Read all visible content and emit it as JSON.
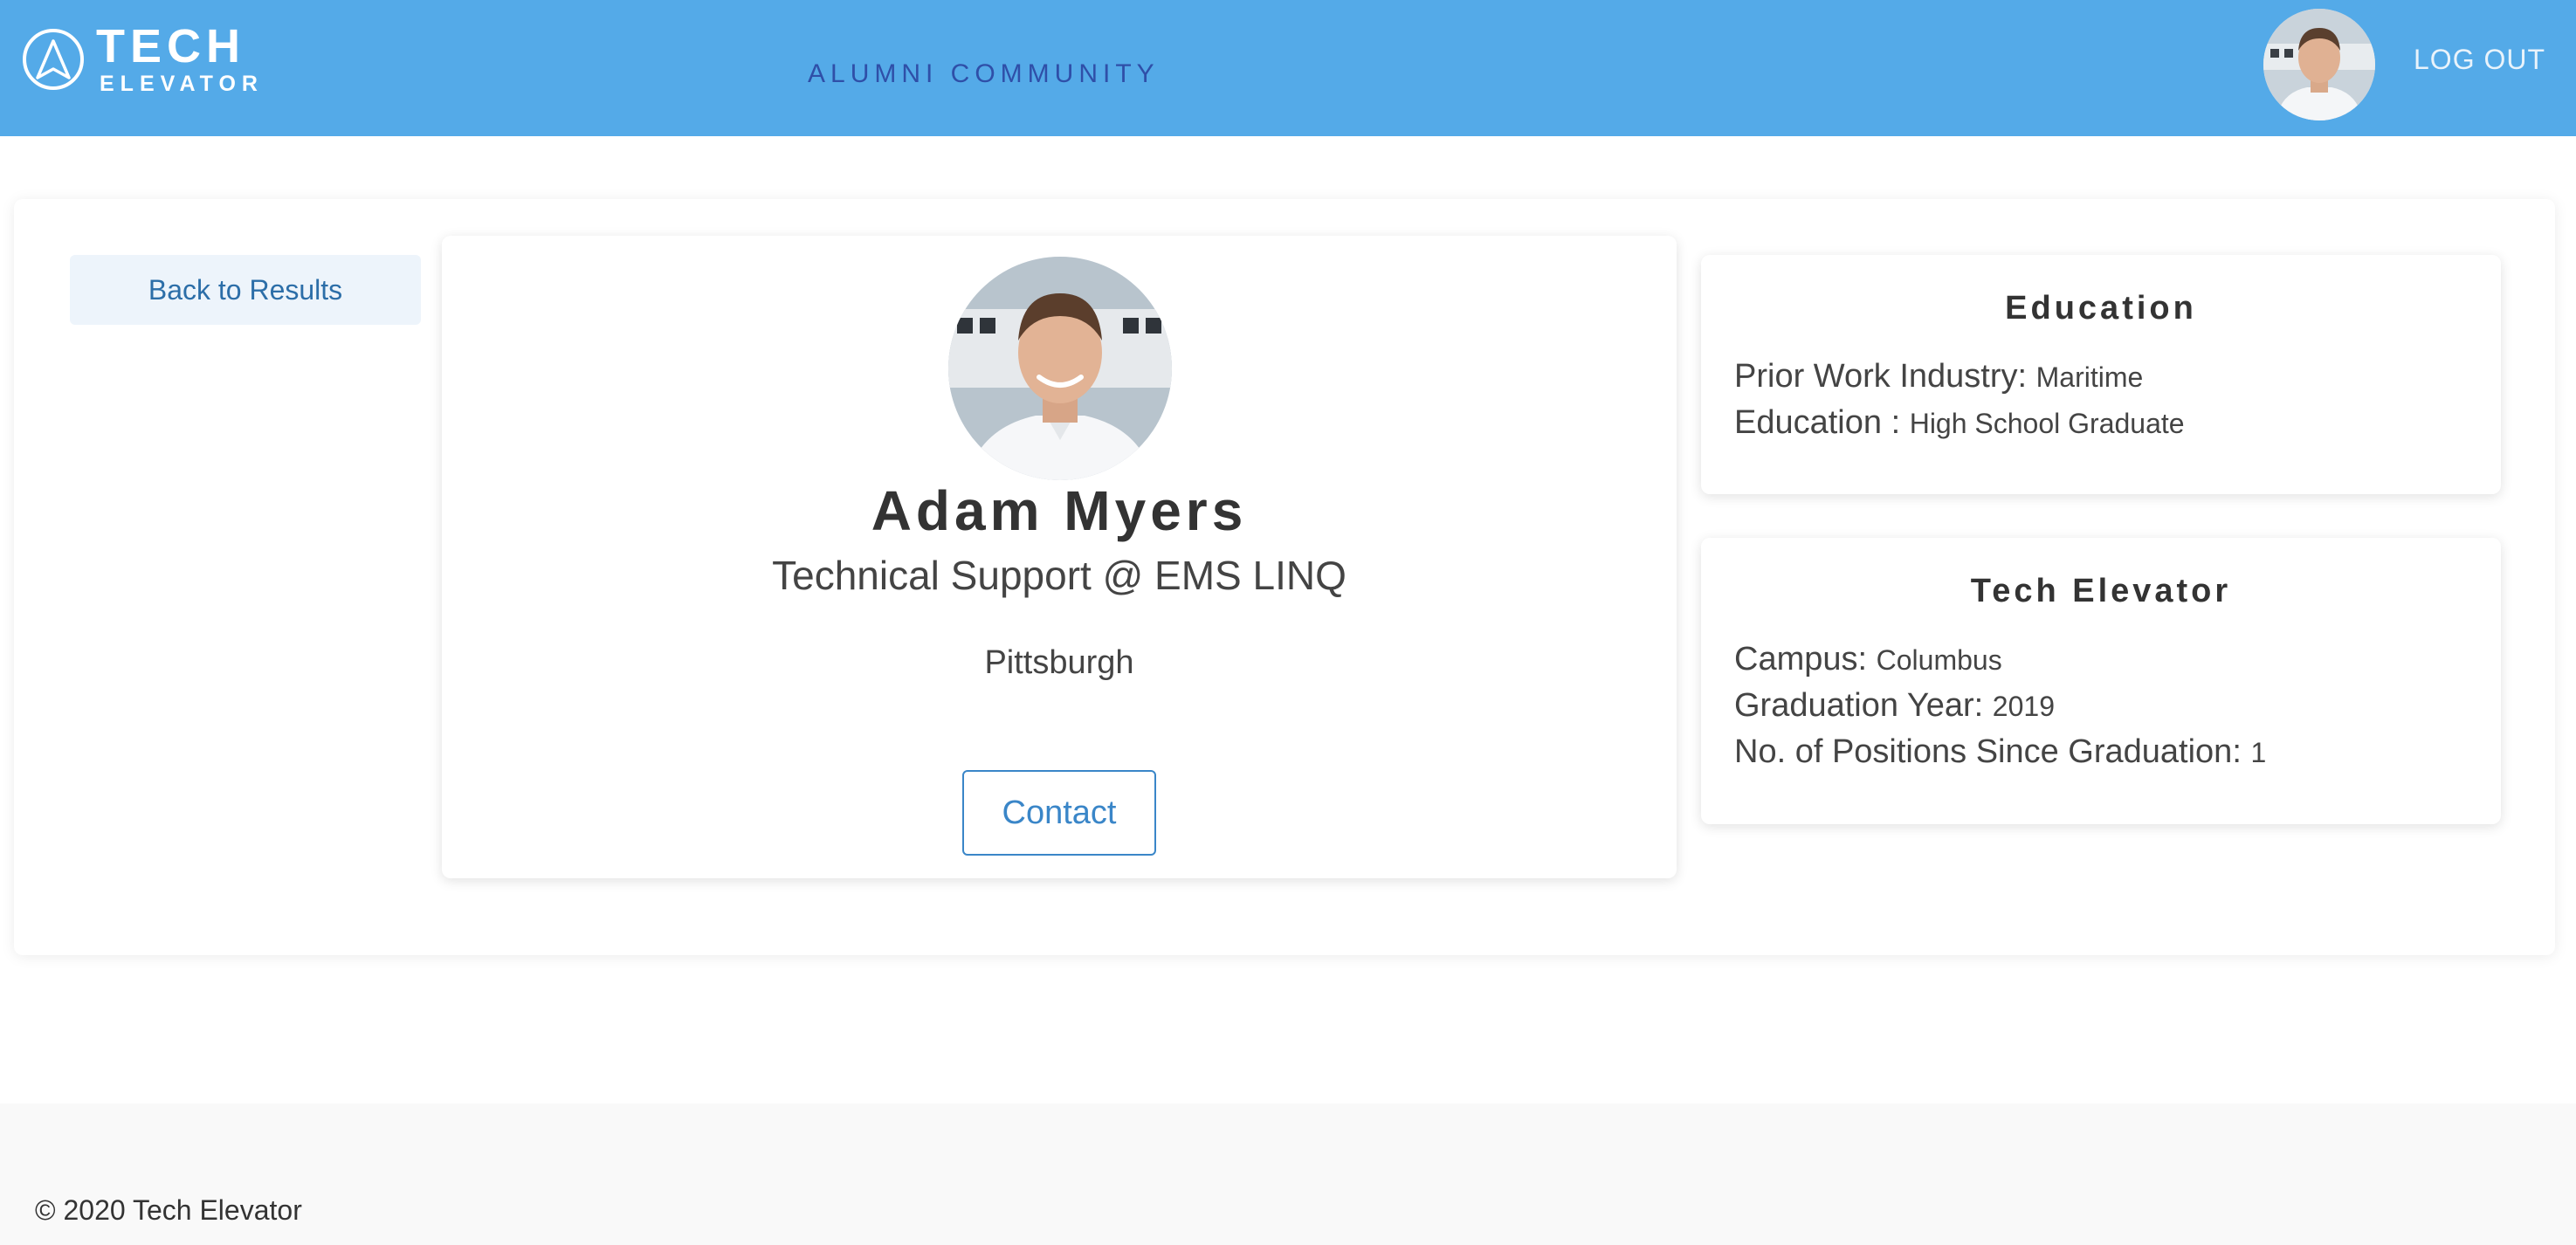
{
  "header": {
    "logo_main": "TECH",
    "logo_sub": "ELEVATOR",
    "nav_title": "ALUMNI COMMUNITY",
    "logout_label": "LOG OUT"
  },
  "sidebar": {
    "back_label": "Back to Results"
  },
  "profile": {
    "name": "Adam Myers",
    "job": "Technical Support @ EMS LINQ",
    "location": "Pittsburgh",
    "contact_label": "Contact"
  },
  "education": {
    "title": "Education",
    "prior_industry_label": "Prior Work Industry:",
    "prior_industry_value": "Maritime",
    "education_label": "Education :",
    "education_value": "High School Graduate"
  },
  "tech_elevator": {
    "title": "Tech Elevator",
    "campus_label": "Campus:",
    "campus_value": "Columbus",
    "grad_year_label": "Graduation Year:",
    "grad_year_value": "2019",
    "positions_label": "No. of Positions Since Graduation:",
    "positions_value": "1"
  },
  "footer": {
    "copyright": "© 2020 Tech Elevator"
  },
  "colors": {
    "header_bg": "#54aae8",
    "nav_title": "#2f4fa8",
    "accent": "#3a86c8"
  }
}
